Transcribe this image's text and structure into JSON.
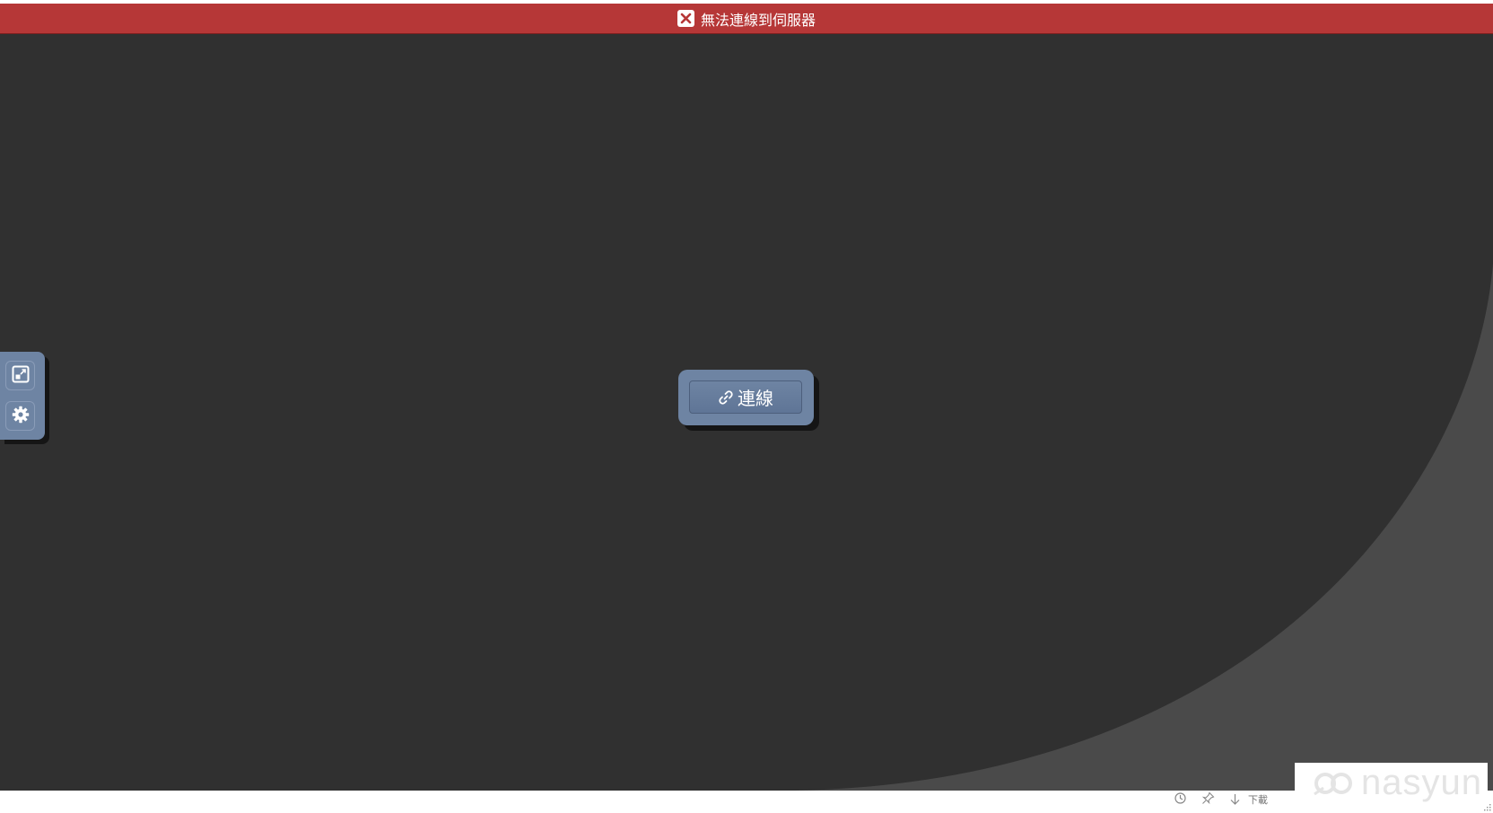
{
  "status": {
    "message": "無法連線到伺服器",
    "icon": "error-x-icon",
    "color": "#b63737"
  },
  "connect_dialog": {
    "button_label": "連線",
    "icon": "link-icon",
    "color": "#6e84a3"
  },
  "control_bar": {
    "items": [
      {
        "name": "fullscreen",
        "icon": "fullscreen-icon"
      },
      {
        "name": "settings",
        "icon": "gear-icon"
      }
    ]
  },
  "bottom_toolbar": {
    "items": [
      {
        "icon": "refresh-icon",
        "label": ""
      },
      {
        "icon": "pin-icon",
        "label": ""
      },
      {
        "icon": "download-arrow-icon",
        "label": "下載"
      }
    ]
  },
  "watermark": {
    "text": "nasyun",
    "icon": "nasyun-logo-icon"
  },
  "colors": {
    "background_dark": "#303030",
    "background_curve": "#4a4a4a"
  }
}
